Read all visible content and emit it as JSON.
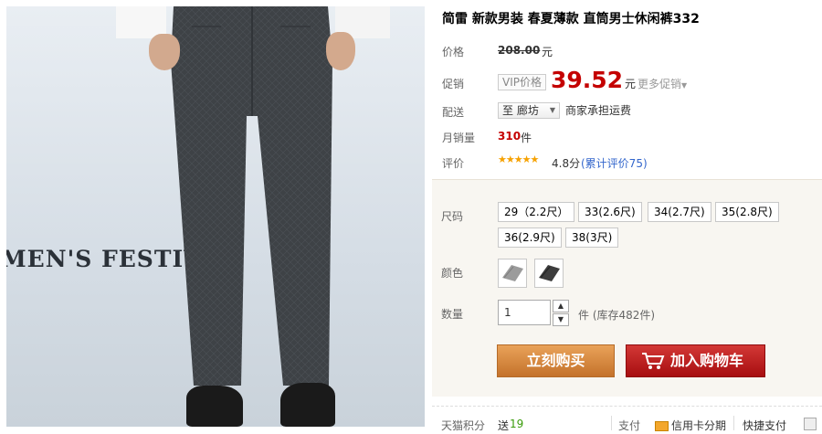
{
  "product": {
    "title": "简雷 新款男装 春夏薄款 直筒男士休闲裤332",
    "image_text": "MEN'S FESTIVAL"
  },
  "price": {
    "label": "价格",
    "original": "208.00",
    "currency": "元"
  },
  "promo": {
    "label": "促销",
    "vip_label": "VIP价格",
    "price": "39.52",
    "currency": "元",
    "more_label": "更多促销"
  },
  "delivery": {
    "label": "配送",
    "region": "至 廊坊",
    "freight": "商家承担运费"
  },
  "monthly_sales": {
    "label": "月销量",
    "count": "310",
    "unit": "件"
  },
  "rating": {
    "label": "评价",
    "stars": "★★★★★",
    "score": "4.8分",
    "reviews": "(累计评价75)"
  },
  "sizes": {
    "label": "尺码",
    "options": [
      "29（2.2尺）",
      "33(2.6尺)",
      "34(2.7尺)",
      "35(2.8尺)",
      "36(2.9尺)",
      "38(3尺)"
    ]
  },
  "colors": {
    "label": "颜色",
    "swatches": [
      "light-gray-pants",
      "dark-gray-pants"
    ]
  },
  "quantity": {
    "label": "数量",
    "value": "1",
    "stock": "件 (库存482件)"
  },
  "buttons": {
    "buy_now": "立刻购买",
    "add_to_cart": "加入购物车"
  },
  "footer": {
    "points_label": "天猫积分",
    "points_prefix": "送",
    "points_value": "19",
    "payment_label": "支付",
    "credit_card": "信用卡分期",
    "express_pay": "快捷支付"
  },
  "colors_theme": {
    "price_red": "#c40000",
    "buy_orange": "#d8863f",
    "cart_red": "#b8151a",
    "link_blue": "#3366cc",
    "star_gold": "#f6a100"
  }
}
